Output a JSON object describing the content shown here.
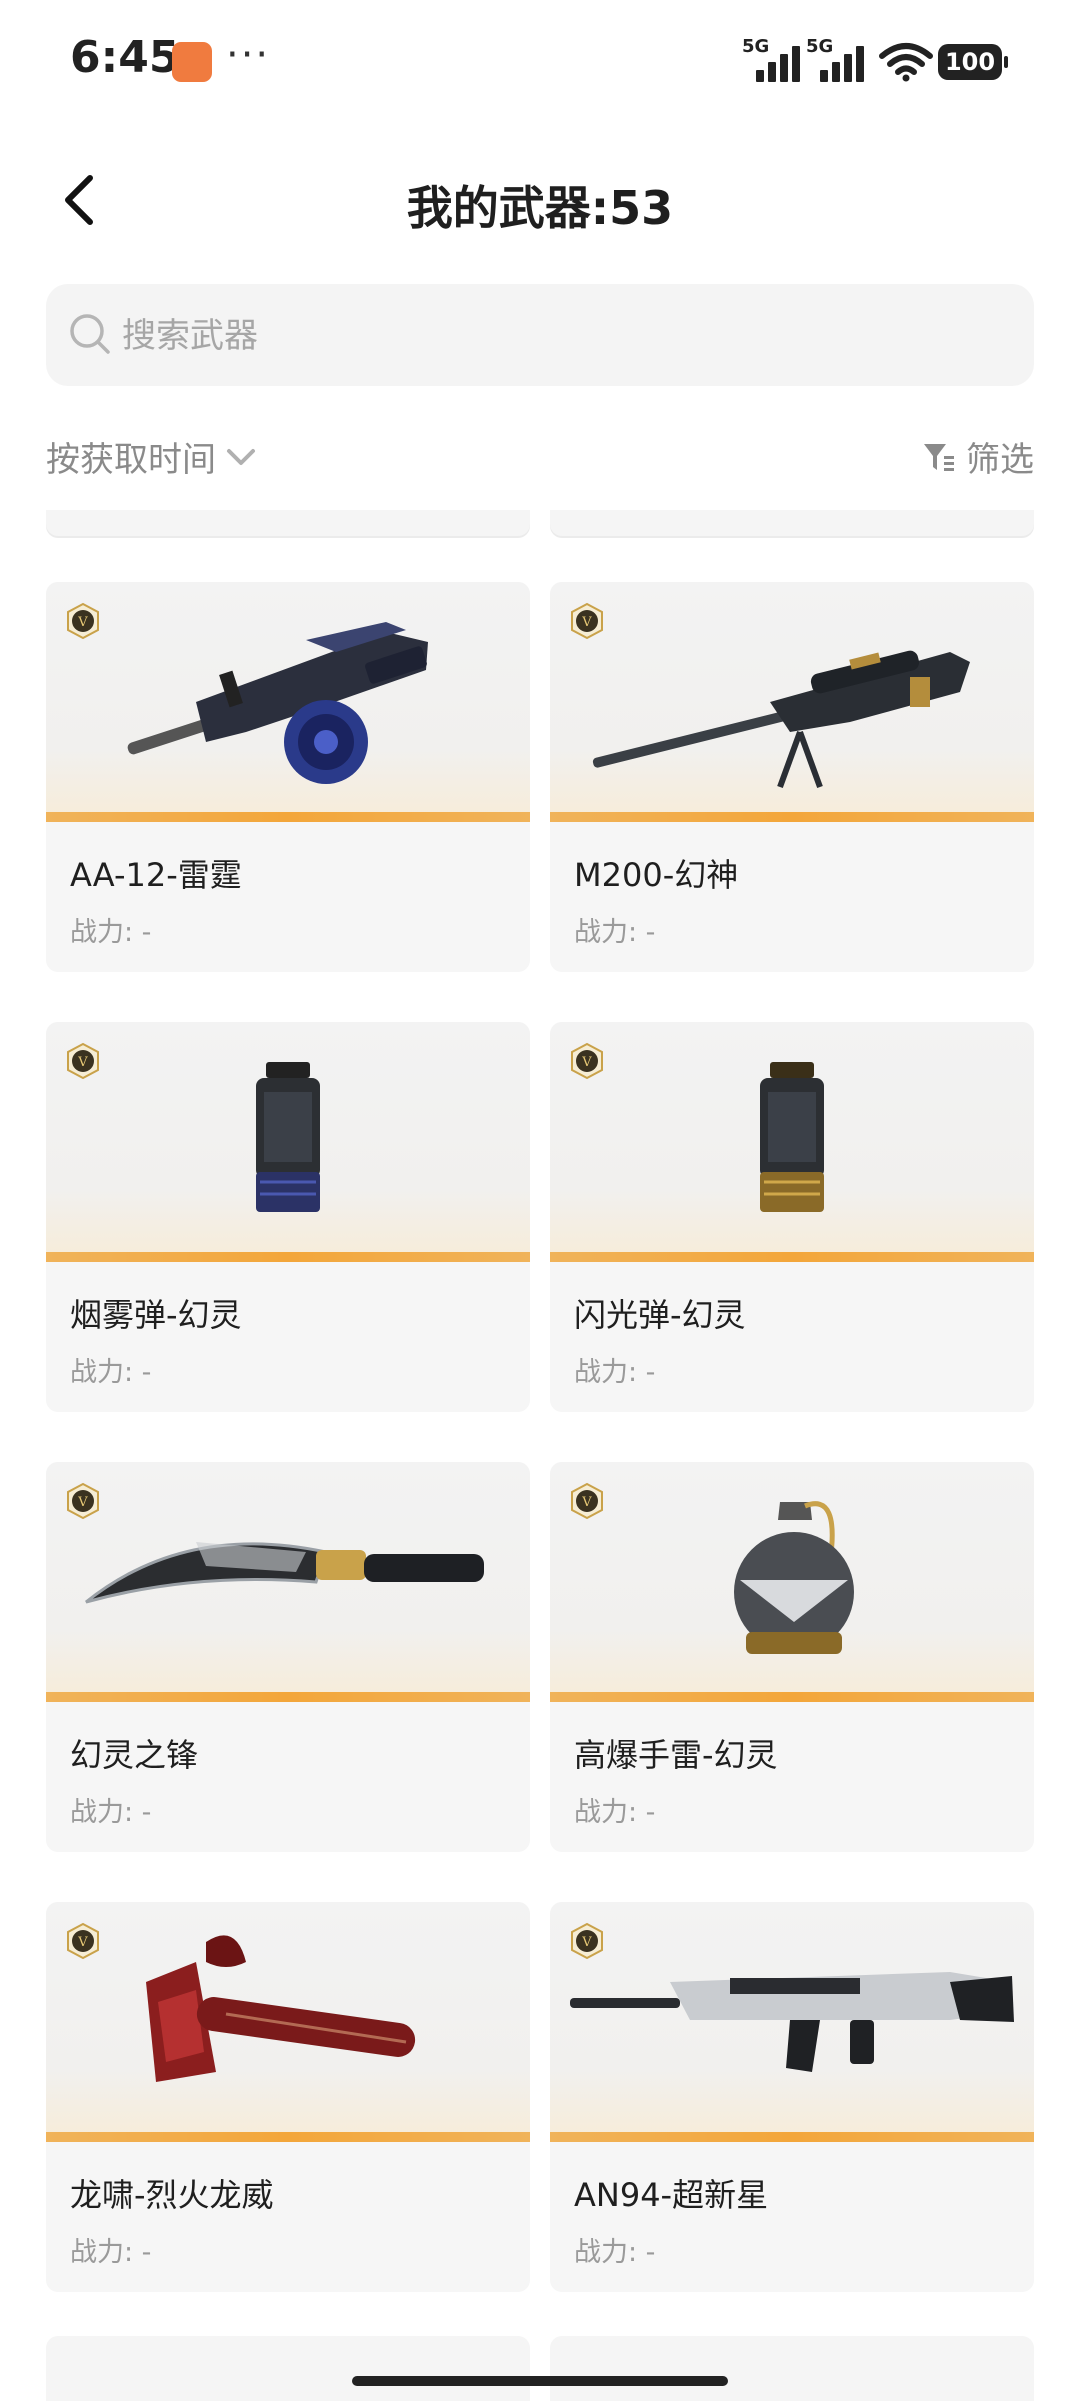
{
  "status_bar": {
    "time": "6:45",
    "more": "···",
    "signal1_label": "5G",
    "signal2_label": "5G",
    "battery": "100",
    "icons": [
      "app-icon",
      "signal-icon",
      "signal-icon",
      "wifi-icon",
      "battery-icon"
    ]
  },
  "header": {
    "title": "我的武器:53",
    "back_icon": "back-arrow-icon"
  },
  "search": {
    "placeholder": "搜索武器",
    "value": ""
  },
  "toolbar": {
    "sort_label": "按获取时间",
    "filter_label": "筛选"
  },
  "weapons": [
    {
      "name": "AA-12-雷霆",
      "power": "战力: -",
      "art": "shotgun-drum"
    },
    {
      "name": "M200-幻神",
      "power": "战力: -",
      "art": "sniper"
    },
    {
      "name": "烟雾弹-幻灵",
      "power": "战力: -",
      "art": "canister-blue"
    },
    {
      "name": "闪光弹-幻灵",
      "power": "战力: -",
      "art": "canister-gold"
    },
    {
      "name": "幻灵之锋",
      "power": "战力: -",
      "art": "machete"
    },
    {
      "name": "高爆手雷-幻灵",
      "power": "战力: -",
      "art": "grenade"
    },
    {
      "name": "龙啸-烈火龙威",
      "power": "战力: -",
      "art": "dragon-axe"
    },
    {
      "name": "AN94-超新星",
      "power": "战力: -",
      "art": "rifle"
    }
  ],
  "colors": {
    "accent_line": "#f3a63a",
    "card_bg": "#f6f6f6",
    "badge_gold": "#c9a24a"
  }
}
